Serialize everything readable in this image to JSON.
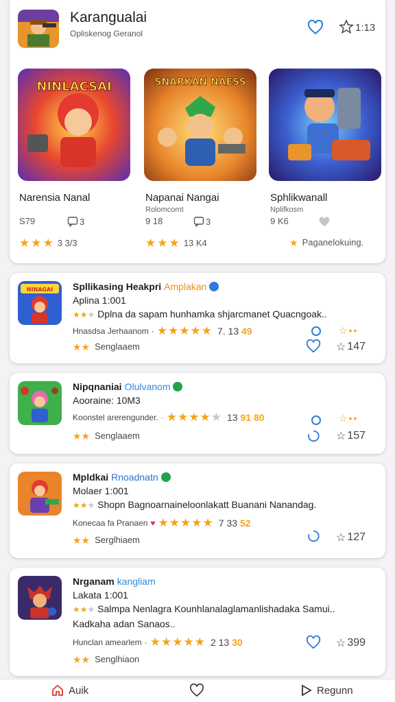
{
  "header": {
    "title": "Karangualai",
    "subtitle": "Opliskenog Geranol",
    "star_count": "1:13",
    "icons": {
      "favorite": "heart-outline",
      "rating": "star-outline"
    }
  },
  "featured": [
    {
      "banner": "NINLACSAI",
      "name": "Narensia Nanal",
      "meta": "",
      "downloads": "S79",
      "comments": "3",
      "rating_text": "3 3/3",
      "stars_filled": 3
    },
    {
      "banner": "SNARKAN NAESS",
      "name": "Napanai Nangai",
      "meta": "Rolomcomt",
      "downloads": "9 18",
      "comments": "3",
      "rating_text": "13 K4",
      "stars_filled": 3
    },
    {
      "banner": "",
      "name": "Sphlikwanall",
      "meta": "Nplifkosm",
      "downloads": "9 K6",
      "comments": "",
      "rating_text": "Paganelokuing.",
      "stars_filled": 1
    }
  ],
  "list": [
    {
      "icon_banner": "NINAGAI",
      "title": "Spllikasing Heakpri",
      "developer": "Amplakan",
      "developer_color": "#f08c1a",
      "verified_color": "#2f7bd9",
      "age_line": "Aplina 1:001",
      "desc_lines": [
        "Dplna da sapam hunhamka shjarcmanet Quacngoak.."
      ],
      "category": "Hnasdsa Jerhaanom",
      "stars_filled": 5,
      "rating": "7. 13",
      "rating_accent": "49",
      "tag": "Senglaaem",
      "star_count": "147"
    },
    {
      "icon_banner": "",
      "title": "Nipqnaniai",
      "developer": "Olulvanom",
      "developer_color": "#2f8ad9",
      "verified_color": "#1ea34b",
      "age_line": "Aooraine: 10M3",
      "desc_lines": [],
      "category": "Koonstel arerengunder.",
      "stars_filled": 4,
      "rating": "13",
      "rating_accent": "91 80",
      "tag": "Senglaaem",
      "star_count": "157"
    },
    {
      "icon_banner": "",
      "title": "Mpldkai",
      "developer": "Rnoadnatn",
      "developer_color": "#2f6fd0",
      "verified_color": "#1ea34b",
      "age_line": "Molaer 1:001",
      "desc_lines": [
        "Shopn Bagnoarnaineloonlakatt Buanani Nanandag."
      ],
      "category": "Konecaa fa Pranaen",
      "stars_filled": 5,
      "rating": "7 33",
      "rating_accent": "52",
      "tag": "Serglhiaem",
      "star_count": "127"
    },
    {
      "icon_banner": "",
      "title": "Nrganam",
      "developer": "kangliam",
      "developer_color": "#2f8ad9",
      "verified_color": "",
      "age_line": "Lakata 1:001",
      "desc_lines": [
        "Salmpa Nenlagra Kounhlanalaglamanlishadaka Samui..",
        "Kadkaha adan Sanaos.."
      ],
      "category": "Hunclan amearlem",
      "stars_filled": 5,
      "rating": "2 13",
      "rating_accent": "30",
      "tag": "Senglhiaon",
      "star_count": "399"
    }
  ],
  "nav": {
    "home": "Auik",
    "favorites": "",
    "share": "Regunn"
  },
  "colors": {
    "accent": "#2f7bd9",
    "star": "#f4a31a",
    "home": "#d93a2f"
  }
}
